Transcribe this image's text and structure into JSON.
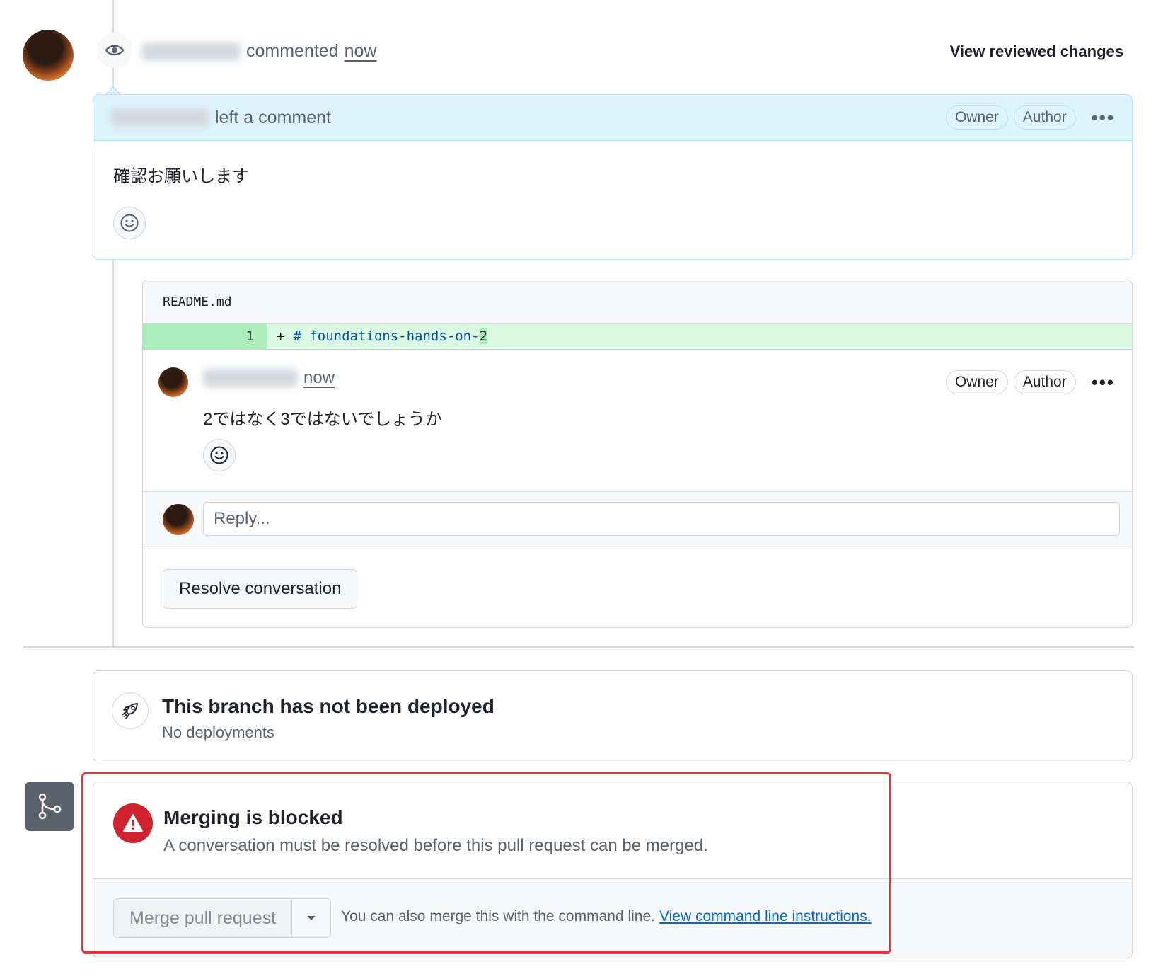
{
  "review_event": {
    "action": "commented",
    "time": "now",
    "view_changes_label": "View reviewed changes"
  },
  "review": {
    "header_text": "left a comment",
    "labels": [
      "Owner",
      "Author"
    ],
    "body": "確認お願いします"
  },
  "thread": {
    "file_name": "README.md",
    "diff_line_number": "1",
    "diff_marker": "+",
    "diff_code_prefix": "# foundations-hands-on-",
    "diff_code_highlight": "2",
    "comment_time": "now",
    "comment_labels": [
      "Owner",
      "Author"
    ],
    "comment_body": "2ではなく3ではないでしょうか",
    "reply_placeholder": "Reply...",
    "resolve_label": "Resolve conversation"
  },
  "deployment": {
    "title": "This branch has not been deployed",
    "subtitle": "No deployments"
  },
  "merge": {
    "title": "Merging is blocked",
    "message": "A conversation must be resolved before this pull request can be merged.",
    "button_label": "Merge pull request",
    "cli_text": "You can also merge this with the command line.",
    "cli_link": "View command line instructions."
  },
  "colors": {
    "accent_blue": "#0969da",
    "danger_red": "#cf222e",
    "highlight_border": "#e5333f",
    "diff_add_bg": "#dafbe1"
  },
  "icons": [
    "eye-icon",
    "smiley-icon",
    "rocket-icon",
    "alert-icon",
    "git-merge-icon",
    "triangle-down-icon",
    "kebab-horizontal-icon"
  ]
}
